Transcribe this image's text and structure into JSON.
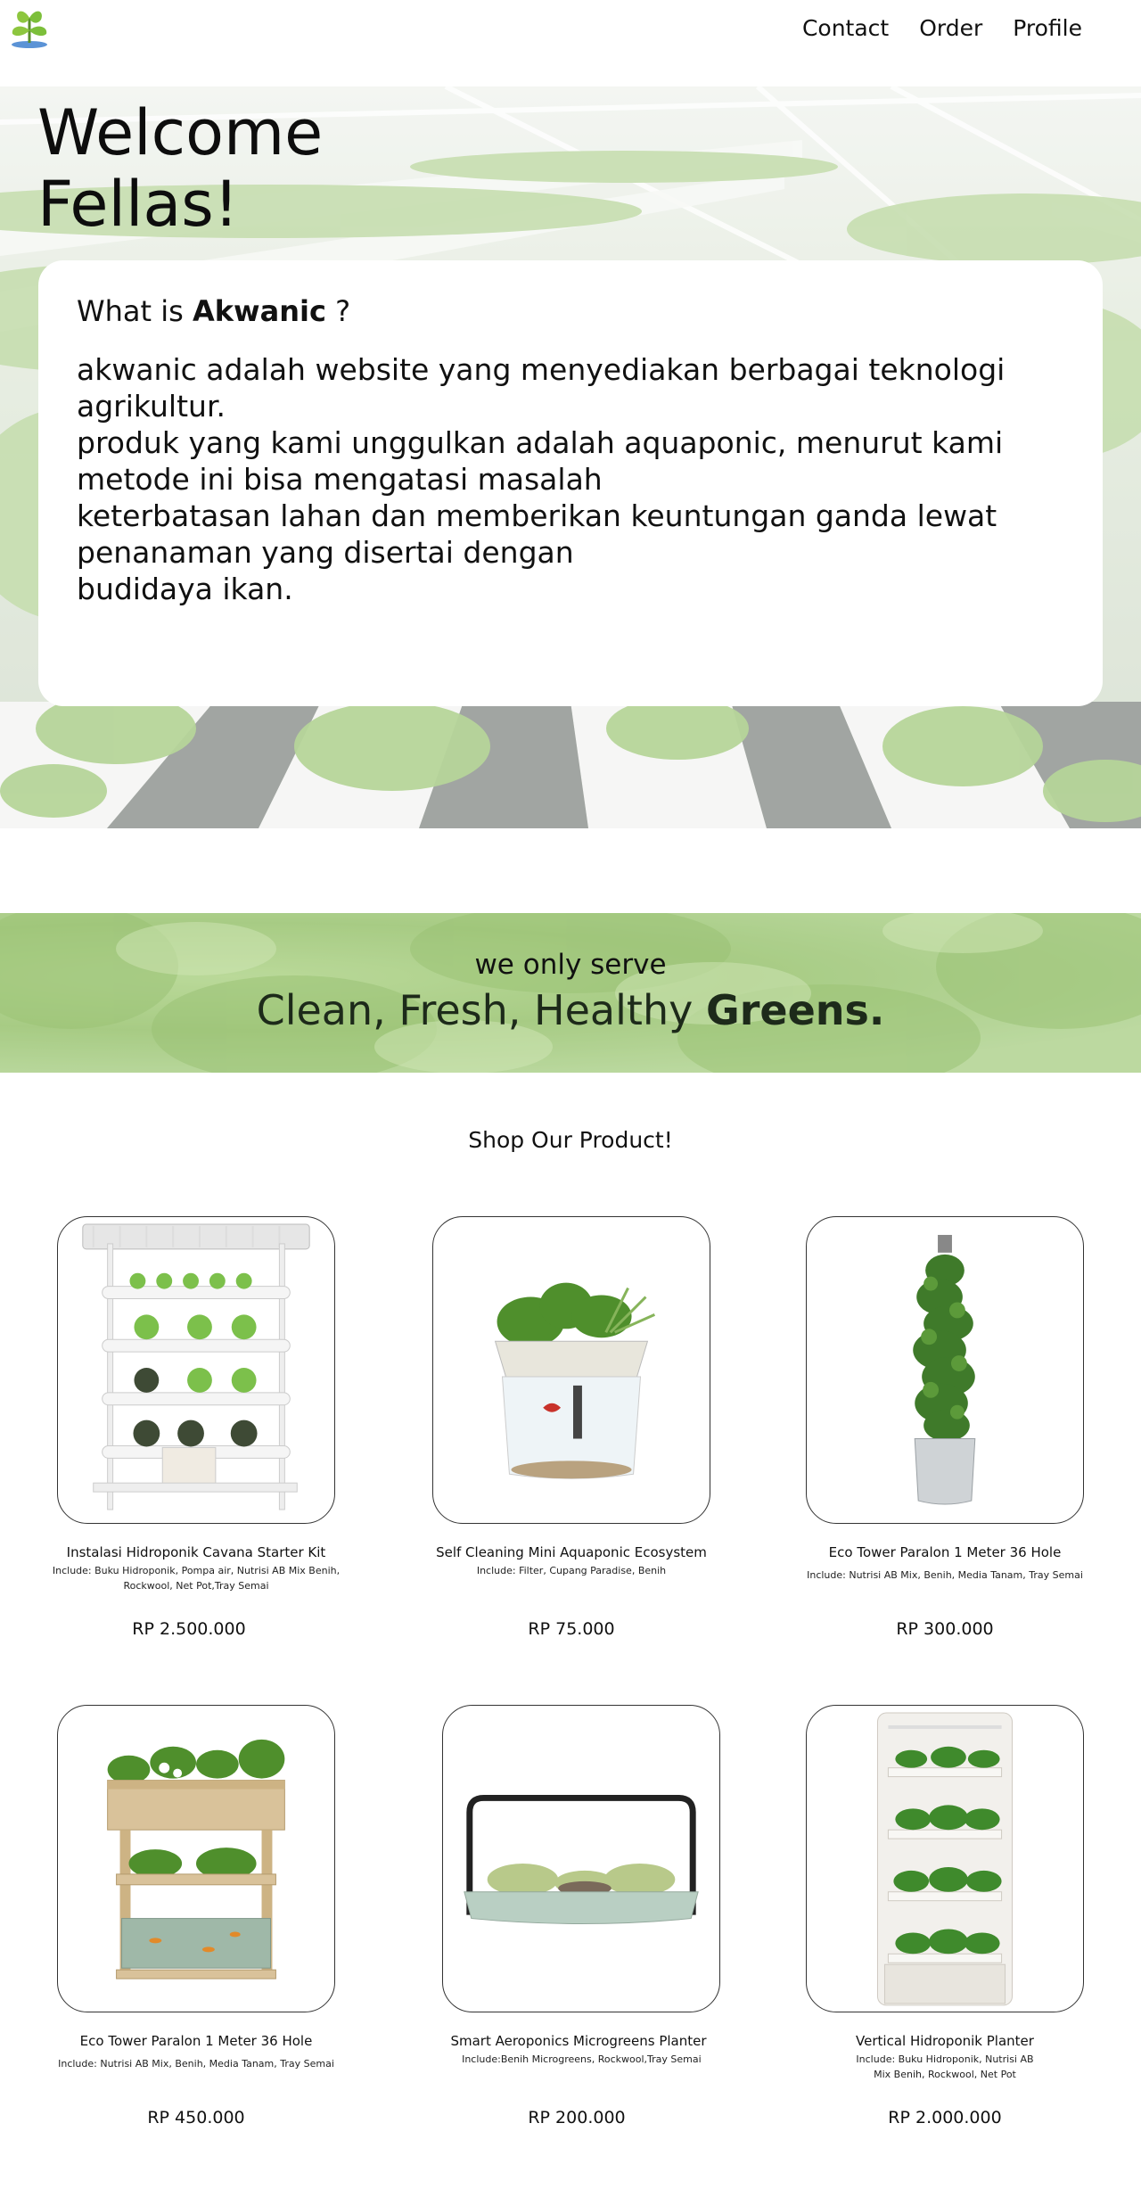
{
  "nav": {
    "logo": "leaf-logo",
    "links": [
      "Contact",
      "Order",
      "Profile"
    ]
  },
  "hero": {
    "title_line1": "Welcome",
    "title_line2": "Fellas!",
    "about_prefix": "What is ",
    "about_brand": "Akwanic",
    "about_suffix": " ?",
    "about_text": "akwanic adalah website yang menyediakan berbagai teknologi agrikultur.\nproduk yang kami unggulkan adalah aquaponic, menurut kami metode ini bisa mengatasi masalah\nketerbatasan lahan dan memberikan keuntungan ganda lewat penanaman yang disertai dengan\nbudidaya ikan."
  },
  "banner": {
    "sub": "we only serve",
    "main_prefix": "Clean, Fresh, Healthy ",
    "main_bold": "Greens."
  },
  "shop": {
    "title": "Shop Our Product!",
    "products": [
      {
        "name": "Instalasi Hidroponik Cavana Starter Kit",
        "include": "Include: Buku Hidroponik, Pompa air, Nutrisi AB Mix Benih, Rockwool, Net Pot,Tray Semai",
        "price": "RP 2.500.000"
      },
      {
        "name": "Self Cleaning Mini Aquaponic Ecosystem",
        "include": "Include: Filter, Cupang Paradise, Benih",
        "price": "RP 75.000"
      },
      {
        "name": "Eco Tower Paralon 1 Meter 36 Hole",
        "include": "Include:  Nutrisi AB Mix, Benih, Media Tanam, Tray Semai",
        "price": "RP 300.000"
      },
      {
        "name": "Eco Tower Paralon 1 Meter 36 Hole",
        "include": "Include:  Nutrisi AB Mix, Benih, Media Tanam, Tray Semai",
        "price": "RP 450.000"
      },
      {
        "name": "Smart Aeroponics Microgreens Planter",
        "include": "Include:Benih Microgreens, Rockwool,Tray Semai",
        "price": "RP 200.000"
      },
      {
        "name": "Vertical Hidroponik Planter",
        "include": "Include: Buku Hidroponik, Nutrisi AB Mix Benih, Rockwool, Net Pot",
        "price": "RP 2.000.000"
      }
    ]
  },
  "colors": {
    "accent_green": "#7cbf3a",
    "dark_green": "#1d2a1a",
    "card_border": "#333333"
  }
}
